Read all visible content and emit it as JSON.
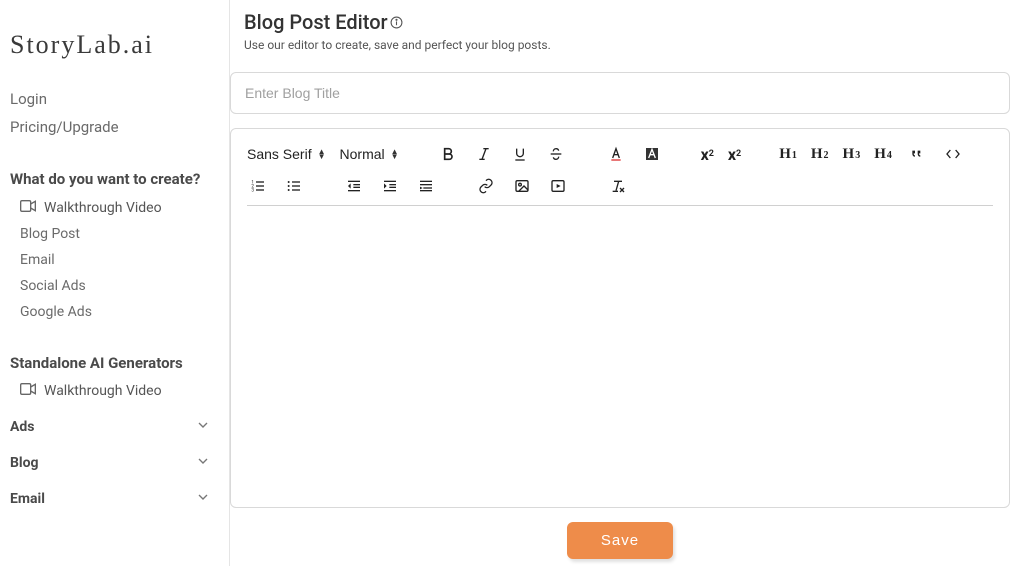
{
  "brand": "StoryLab.ai",
  "top_links": {
    "login": "Login",
    "pricing": "Pricing/Upgrade"
  },
  "sidebar": {
    "section_create": "What do you want to create?",
    "walkthrough": "Walkthrough Video",
    "create_items": [
      "Blog Post",
      "Email",
      "Social Ads",
      "Google Ads"
    ],
    "section_generators": "Standalone AI Generators",
    "accordion": [
      "Ads",
      "Blog",
      "Email"
    ]
  },
  "page": {
    "title": "Blog Post Editor",
    "subtitle": "Use our editor to create, save and perfect your blog posts."
  },
  "editor": {
    "title_placeholder": "Enter Blog Title",
    "font_picker": "Sans Serif",
    "size_picker": "Normal",
    "save_label": "Save"
  }
}
